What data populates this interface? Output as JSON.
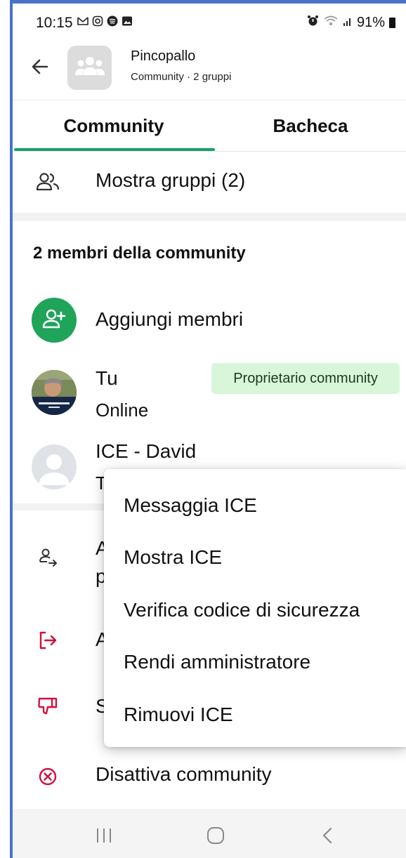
{
  "status_bar": {
    "time": "10:15",
    "battery": "91%"
  },
  "header": {
    "title": "Pincopallo",
    "subtitle": "Community · 2 gruppi"
  },
  "tabs": [
    {
      "label": "Community",
      "active": true
    },
    {
      "label": "Bacheca",
      "active": false
    }
  ],
  "groups_row": {
    "label": "Mostra gruppi (2)"
  },
  "members_section": {
    "title": "2 membri della community"
  },
  "add_members": {
    "label": "Aggiungi membri"
  },
  "members": [
    {
      "name": "Tu",
      "status": "Online",
      "badge": "Proprietario community"
    },
    {
      "name": "ICE - David",
      "status": "T"
    }
  ],
  "actions": [
    {
      "label": "A",
      "label2": "p",
      "icon": "person-transfer-icon"
    },
    {
      "label": "A",
      "icon": "exit-icon"
    },
    {
      "label": "S",
      "icon": "thumbs-down-icon"
    },
    {
      "label": "Disattiva community",
      "icon": "close-circle-icon"
    }
  ],
  "context_menu": {
    "items": [
      "Messaggia ICE",
      "Mostra ICE",
      "Verifica codice di sicurezza",
      "Rendi amministratore",
      "Rimuovi ICE"
    ]
  },
  "colors": {
    "accent_green": "#1fa45a",
    "danger_red": "#d0103a",
    "badge_bg": "#d8f6da"
  }
}
